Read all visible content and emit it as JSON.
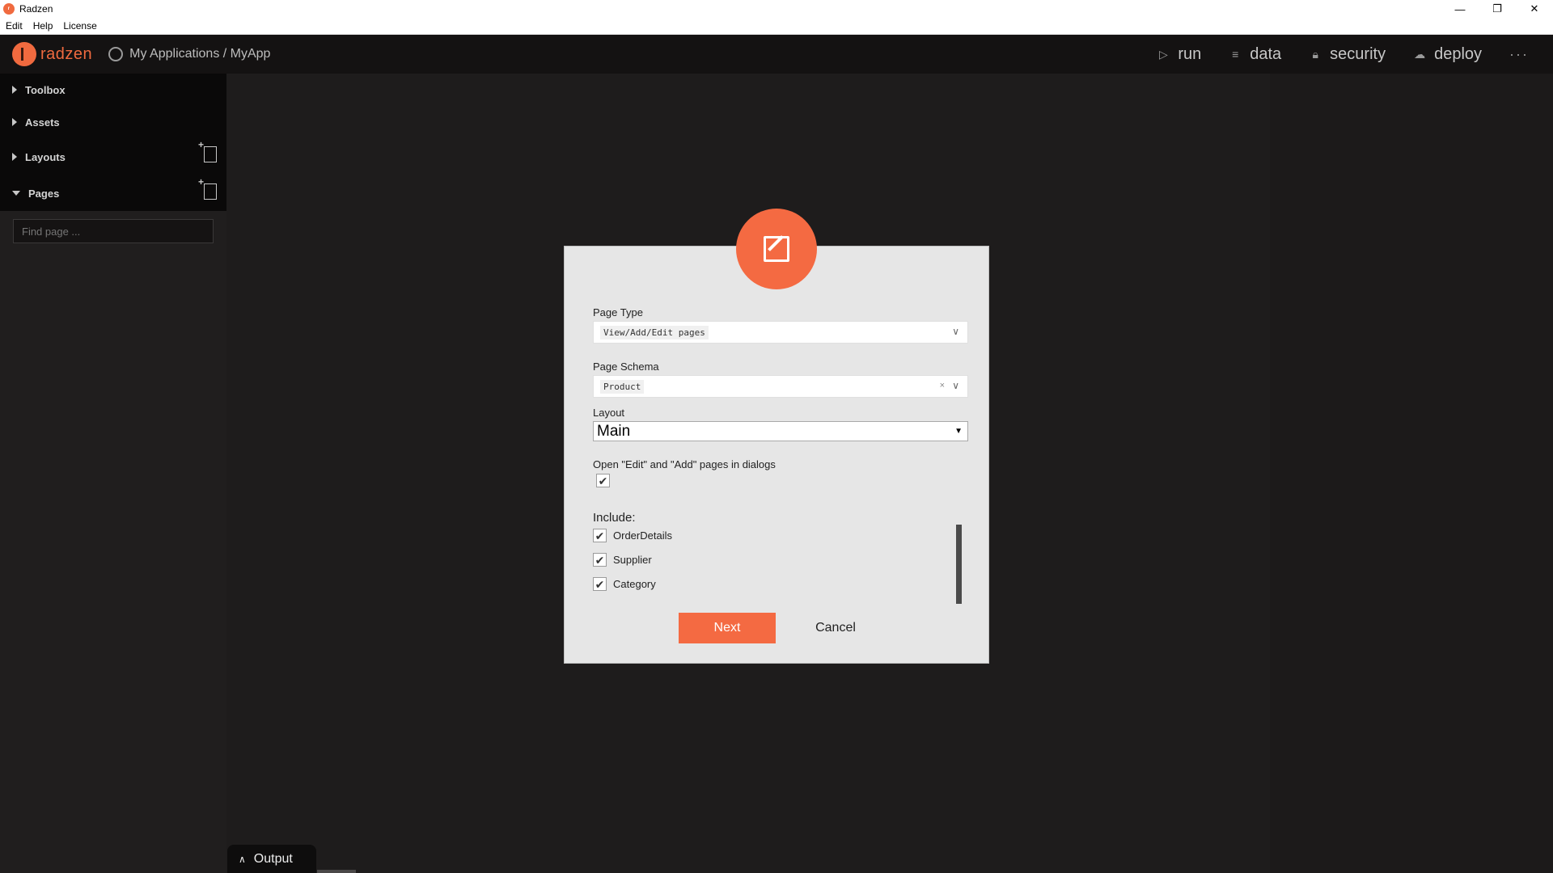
{
  "window": {
    "title": "Radzen",
    "icon": "radzen-app-icon",
    "controls": [
      "minimize",
      "restore",
      "close"
    ]
  },
  "menubar": {
    "items": [
      "Edit",
      "Help",
      "License"
    ]
  },
  "header": {
    "logo_text": "radzen",
    "breadcrumb": "My Applications / MyApp",
    "actions": [
      {
        "label": "run",
        "icon": "play-icon"
      },
      {
        "label": "data",
        "icon": "layers-icon"
      },
      {
        "label": "security",
        "icon": "lock-icon"
      },
      {
        "label": "deploy",
        "icon": "cloud-upload-icon"
      }
    ],
    "more": "···"
  },
  "sidebar": {
    "items": [
      {
        "label": "Toolbox",
        "expanded": false
      },
      {
        "label": "Assets",
        "expanded": false
      },
      {
        "label": "Layouts",
        "expanded": false
      },
      {
        "label": "Pages",
        "expanded": true
      }
    ],
    "find_placeholder": "Find page ..."
  },
  "dialog": {
    "page_type": {
      "label": "Page Type",
      "value": "View/Add/Edit pages"
    },
    "page_schema": {
      "label": "Page Schema",
      "value": "Product",
      "clear": "×"
    },
    "layout": {
      "label": "Layout",
      "value": "Main"
    },
    "dialogs_option": {
      "label": "Open \"Edit\" and \"Add\" pages in dialogs",
      "checked": true
    },
    "include": {
      "label": "Include:",
      "items": [
        {
          "label": "OrderDetails",
          "checked": true
        },
        {
          "label": "Supplier",
          "checked": true
        },
        {
          "label": "Category",
          "checked": true
        }
      ]
    },
    "next_label": "Next",
    "cancel_label": "Cancel"
  },
  "output": {
    "label": "Output"
  },
  "colors": {
    "accent": "#f46a42",
    "header_bg": "#141212",
    "canvas_bg": "#1e1c1c",
    "dialog_bg": "#e6e6e6"
  }
}
